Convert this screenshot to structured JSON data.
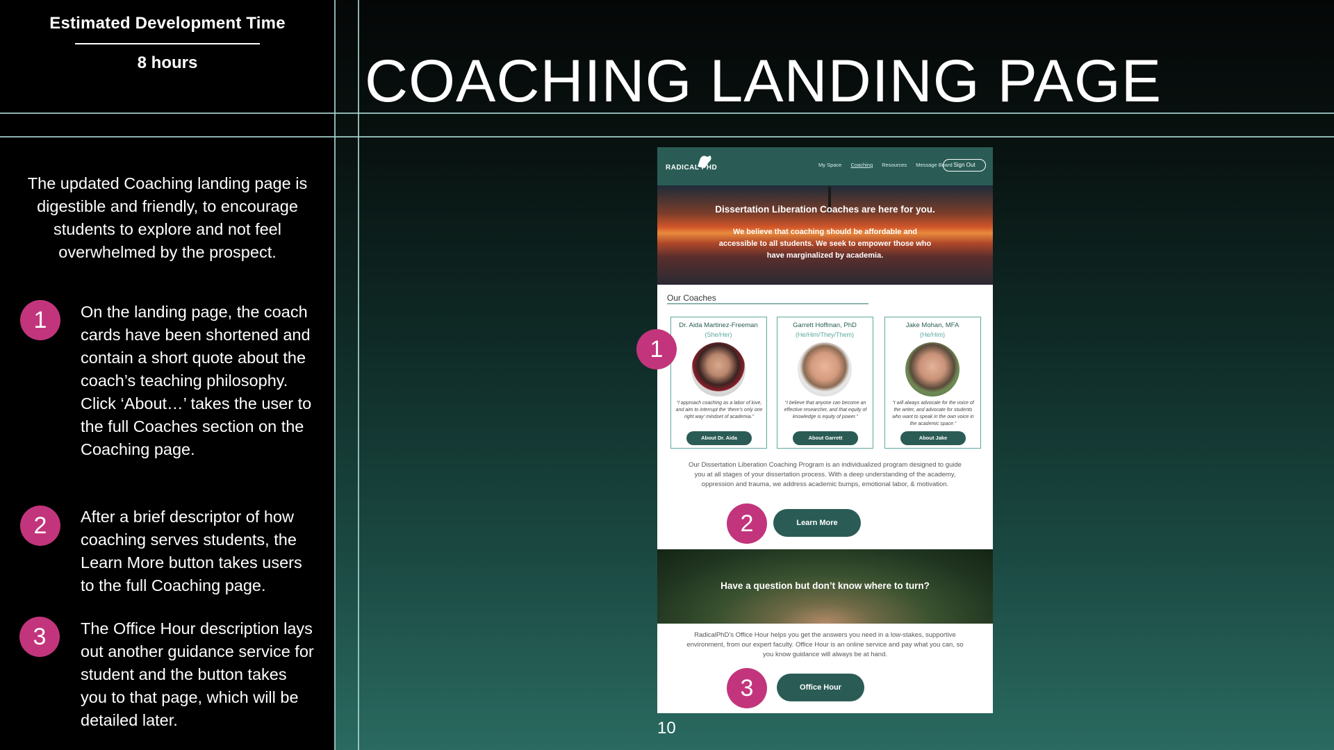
{
  "header": {
    "estimate_label": "Estimated Development Time",
    "estimate_value": "8 hours",
    "title": "COACHING LANDING PAGE"
  },
  "sidebar": {
    "intro": "The updated Coaching landing page is digestible and friendly, to encourage students to explore and not feel overwhelmed by the prospect.",
    "steps": [
      {
        "number": "1",
        "text": "On the landing page, the coach cards have been shortened and contain a short quote about the coach’s teaching philosophy. Click ‘About…’ takes the user to the full Coaches section on the Coaching page."
      },
      {
        "number": "2",
        "text": "After a brief descriptor of how coaching serves students, the Learn More button takes users to the full Coaching page."
      },
      {
        "number": "3",
        "text": "The Office Hour description lays out another guidance service for student and the button takes you to that page, which will be detailed later."
      }
    ]
  },
  "mockup": {
    "logo_text": "RADICAL PHD",
    "nav": [
      "My Space",
      "Coaching",
      "Resources",
      "Message Board"
    ],
    "sign_out": "Sign Out",
    "hero_title": "Dissertation Liberation Coaches are here for you.",
    "hero_body": "We believe that coaching should be affordable and accessible to all students. We seek to empower those who have marginalized by academia.",
    "coaches_label": "Our Coaches",
    "coaches": [
      {
        "name": "Dr. Aida Martinez-Freeman",
        "pronouns": "(She/Her)",
        "quote": "“I approach coaching as a labor of love, and aim to interrupt the ‘there’s only one right way’ mindset of academia.”",
        "button": "About Dr. Aida"
      },
      {
        "name": "Garrett Hoffman, PhD",
        "pronouns": "(He/Him/They/Them)",
        "quote": "“I believe that anyone can become an effective researcher, and that equity of knowledge is equity of power.”",
        "button": "About Garrett"
      },
      {
        "name": "Jake Mohan, MFA",
        "pronouns": "(He/Him)",
        "quote": "“I will always advocate for the voice of the writer, and advocate for students who want to speak in the own voice in the academic space.”",
        "button": "About Jake"
      }
    ],
    "program_text": "Our Dissertation Liberation Coaching Program is an individualized program designed to guide you at all stages of your dissertation process. With a deep understanding of the academy, oppression and trauma, we address academic bumps, emotional labor, & motivation.",
    "learn_more": "Learn More",
    "question_title": "Have a question but don’t know where to turn?",
    "office_text": "RadicalPhD’s Office Hour helps you get the answers you need in a low-stakes, supportive environment, from our expert faculty. Office Hour is an online service and pay what you can, so you know guidance will always be at hand.",
    "office_hour": "Office Hour",
    "badges": [
      "1",
      "2",
      "3"
    ]
  },
  "page_number": "10",
  "colors": {
    "badge": "#c2357c",
    "brand_teal": "#2a5c55",
    "guide_line": "#a7d4cf"
  }
}
